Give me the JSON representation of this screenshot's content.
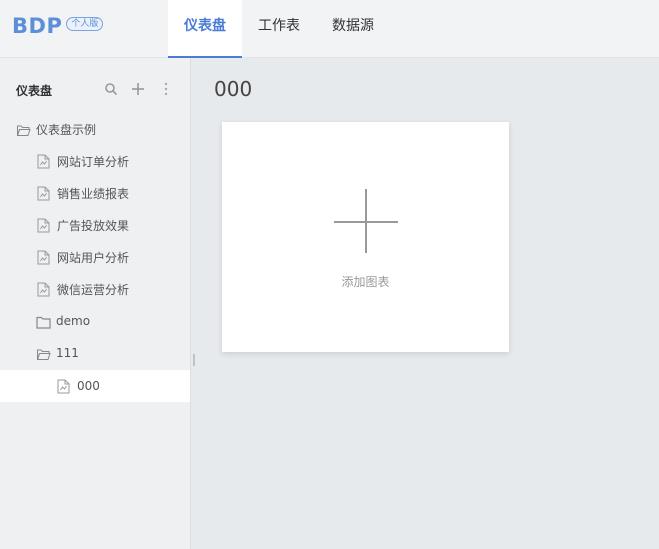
{
  "header": {
    "logo": "BDP",
    "edition_badge": "个人版",
    "tabs": [
      {
        "label": "仪表盘",
        "active": true
      },
      {
        "label": "工作表",
        "active": false
      },
      {
        "label": "数据源",
        "active": false
      }
    ]
  },
  "sidebar": {
    "title": "仪表盘",
    "actions": [
      "search-icon",
      "plus-icon",
      "more-vertical-icon"
    ],
    "tree": [
      {
        "label": "仪表盘示例",
        "type": "folder-open",
        "level": 0
      },
      {
        "label": "网站订单分析",
        "type": "dashboard",
        "level": 1
      },
      {
        "label": "销售业绩报表",
        "type": "dashboard",
        "level": 1
      },
      {
        "label": "广告投放效果",
        "type": "dashboard",
        "level": 1
      },
      {
        "label": "网站用户分析",
        "type": "dashboard",
        "level": 1
      },
      {
        "label": "微信运营分析",
        "type": "dashboard",
        "level": 1
      },
      {
        "label": "demo",
        "type": "folder",
        "level": 1
      },
      {
        "label": "111",
        "type": "folder-open",
        "level": 1
      },
      {
        "label": "000",
        "type": "dashboard",
        "level": 2,
        "selected": true
      }
    ]
  },
  "main": {
    "title": "000",
    "add_chart_label": "添加图表"
  },
  "colors": {
    "accent": "#4a7bd6",
    "header_bg": "#f2f3f5",
    "sidebar_bg": "#eef0f2",
    "canvas_bg": "#e7eaed"
  }
}
